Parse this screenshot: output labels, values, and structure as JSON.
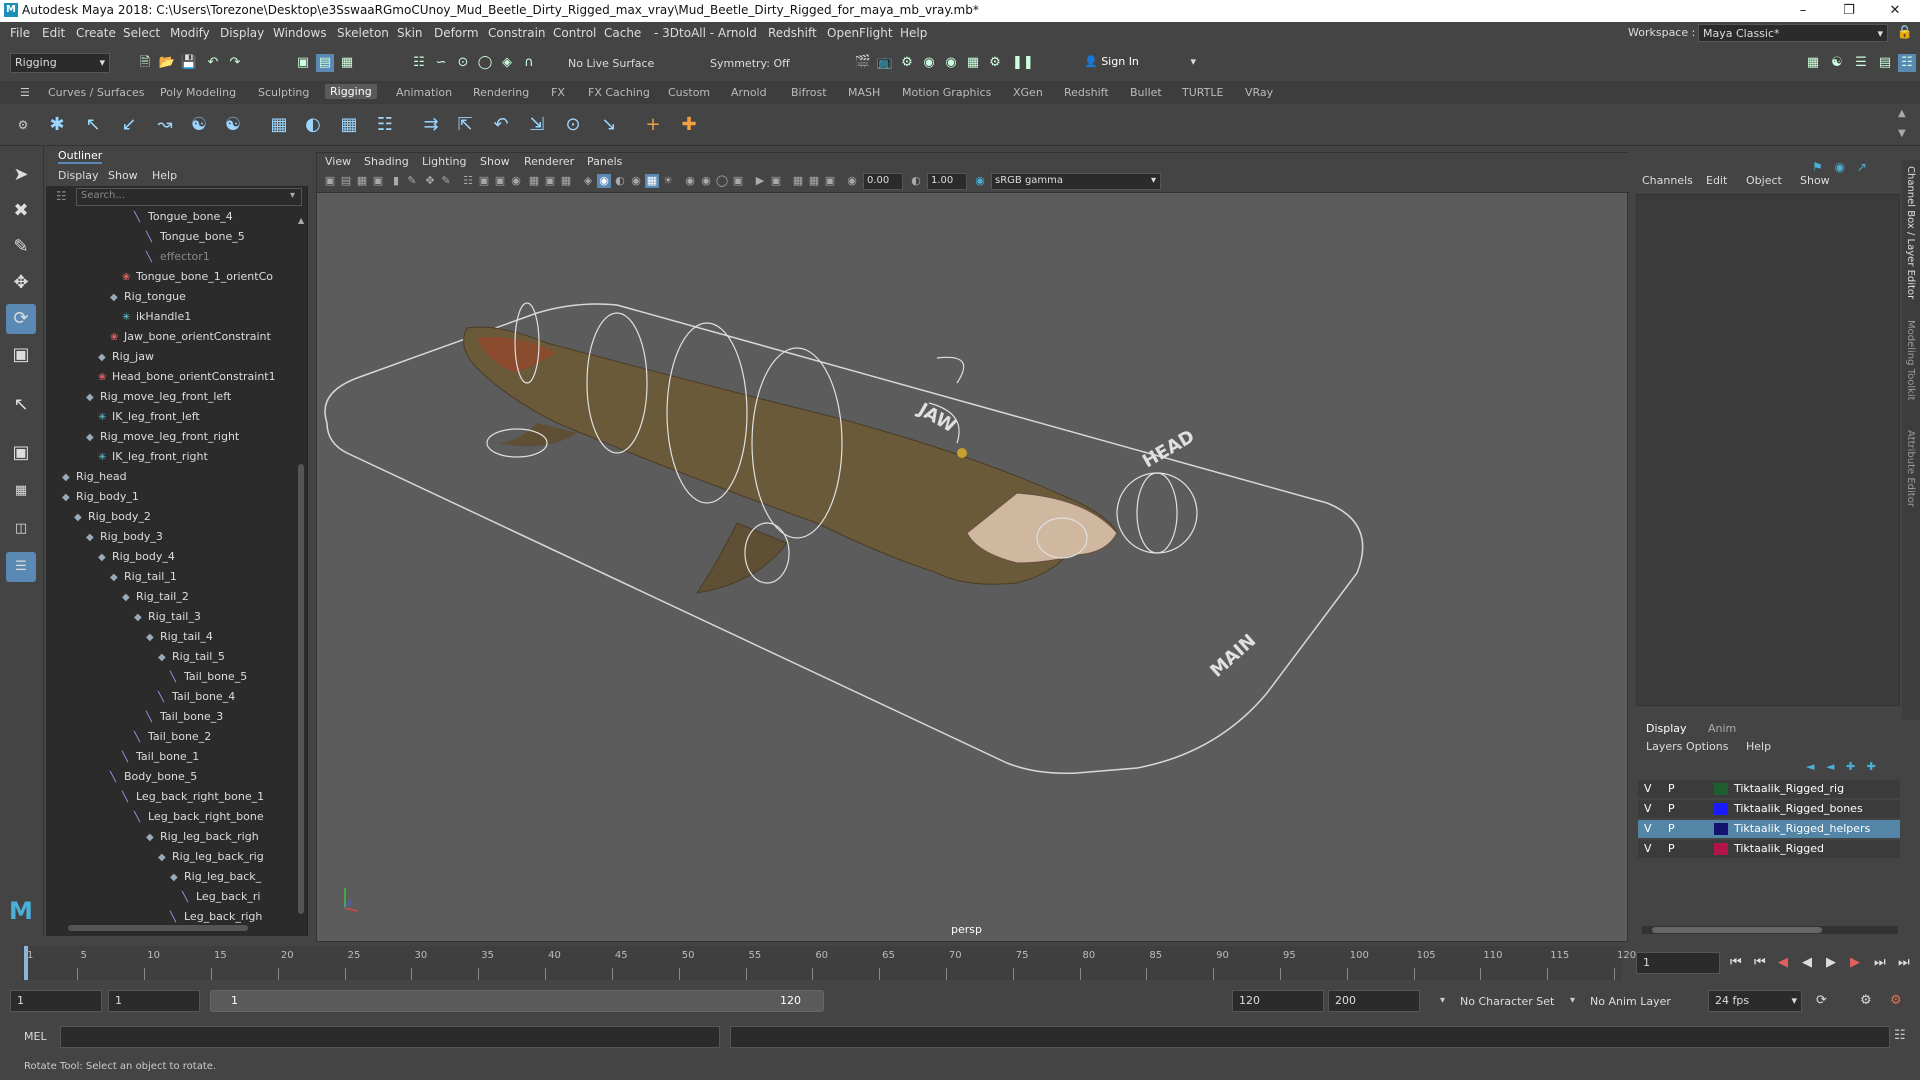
{
  "window": {
    "title": "Autodesk Maya 2018: C:\\Users\\Torezone\\Desktop\\e3SswaaRGmoCUnoy_Mud_Beetle_Dirty_Rigged_max_vray\\Mud_Beetle_Dirty_Rigged_for_maya_mb_vray.mb*",
    "logo": "M"
  },
  "menu": [
    "File",
    "Edit",
    "Create",
    "Select",
    "Modify",
    "Display",
    "Windows",
    "Skeleton",
    "Skin",
    "Deform",
    "Constrain",
    "Control",
    "Cache",
    "- 3DtoAll -",
    "Arnold",
    "Redshift",
    "OpenFlight",
    "Help"
  ],
  "workspace": {
    "label": "Workspace :",
    "value": "Maya Classic*"
  },
  "statusline": {
    "mode": "Rigging",
    "live_surface": "No Live Surface",
    "symmetry": "Symmetry: Off",
    "sign_in": "Sign In"
  },
  "shelf_tabs": [
    "Curves / Surfaces",
    "Poly Modeling",
    "Sculpting",
    "Rigging",
    "Animation",
    "Rendering",
    "FX",
    "FX Caching",
    "Custom",
    "Arnold",
    "Bifrost",
    "MASH",
    "Motion Graphics",
    "XGen",
    "Redshift",
    "Bullet",
    "TURTLE",
    "VRay"
  ],
  "active_shelf": "Rigging",
  "outliner": {
    "title": "Outliner",
    "menu": [
      "Display",
      "Show",
      "Help"
    ],
    "search_placeholder": "Search...",
    "rows": [
      {
        "label": "Tongue_bone_4",
        "indent": 8,
        "icon": "joint"
      },
      {
        "label": "Tongue_bone_5",
        "indent": 9,
        "icon": "joint"
      },
      {
        "label": "effector1",
        "indent": 9,
        "icon": "joint",
        "dim": true
      },
      {
        "label": "Tongue_bone_1_orientCo",
        "indent": 7,
        "icon": "const"
      },
      {
        "label": "Rig_tongue",
        "indent": 6,
        "icon": "ctrl"
      },
      {
        "label": "ikHandle1",
        "indent": 7,
        "icon": "ik"
      },
      {
        "label": "Jaw_bone_orientConstraint",
        "indent": 6,
        "icon": "const"
      },
      {
        "label": "Rig_jaw",
        "indent": 5,
        "icon": "ctrl"
      },
      {
        "label": "Head_bone_orientConstraint1",
        "indent": 5,
        "icon": "const"
      },
      {
        "label": "Rig_move_leg_front_left",
        "indent": 4,
        "icon": "ctrl"
      },
      {
        "label": "IK_leg_front_left",
        "indent": 5,
        "icon": "ik"
      },
      {
        "label": "Rig_move_leg_front_right",
        "indent": 4,
        "icon": "ctrl"
      },
      {
        "label": "IK_leg_front_right",
        "indent": 5,
        "icon": "ik"
      },
      {
        "label": "Rig_head",
        "indent": 2,
        "icon": "ctrl"
      },
      {
        "label": "Rig_body_1",
        "indent": 2,
        "icon": "ctrl"
      },
      {
        "label": "Rig_body_2",
        "indent": 3,
        "icon": "ctrl"
      },
      {
        "label": "Rig_body_3",
        "indent": 4,
        "icon": "ctrl"
      },
      {
        "label": "Rig_body_4",
        "indent": 5,
        "icon": "ctrl"
      },
      {
        "label": "Rig_tail_1",
        "indent": 6,
        "icon": "ctrl"
      },
      {
        "label": "Rig_tail_2",
        "indent": 7,
        "icon": "ctrl"
      },
      {
        "label": "Rig_tail_3",
        "indent": 8,
        "icon": "ctrl"
      },
      {
        "label": "Rig_tail_4",
        "indent": 9,
        "icon": "ctrl"
      },
      {
        "label": "Rig_tail_5",
        "indent": 10,
        "icon": "ctrl"
      },
      {
        "label": "Tail_bone_5",
        "indent": 11,
        "icon": "joint"
      },
      {
        "label": "Tail_bone_4",
        "indent": 10,
        "icon": "joint"
      },
      {
        "label": "Tail_bone_3",
        "indent": 9,
        "icon": "joint"
      },
      {
        "label": "Tail_bone_2",
        "indent": 8,
        "icon": "joint"
      },
      {
        "label": "Tail_bone_1",
        "indent": 7,
        "icon": "joint"
      },
      {
        "label": "Body_bone_5",
        "indent": 6,
        "icon": "joint"
      },
      {
        "label": "Leg_back_right_bone_1",
        "indent": 7,
        "icon": "joint"
      },
      {
        "label": "Leg_back_right_bone",
        "indent": 8,
        "icon": "joint"
      },
      {
        "label": "Rig_leg_back_righ",
        "indent": 9,
        "icon": "ctrl"
      },
      {
        "label": "Rig_leg_back_rig",
        "indent": 10,
        "icon": "ctrl"
      },
      {
        "label": "Rig_leg_back_",
        "indent": 11,
        "icon": "ctrl"
      },
      {
        "label": "Leg_back_ri",
        "indent": 12,
        "icon": "joint"
      },
      {
        "label": "Leg_back_righ",
        "indent": 11,
        "icon": "joint"
      }
    ]
  },
  "viewport": {
    "menu": [
      "View",
      "Shading",
      "Lighting",
      "Show",
      "Renderer",
      "Panels"
    ],
    "field_a": "0.00",
    "field_b": "1.00",
    "color_space": "sRGB gamma",
    "camera": "persp",
    "labels": {
      "jaw": "JAW",
      "head": "HEAD",
      "main": "MAIN"
    }
  },
  "channel_box": {
    "menu": [
      "Channels",
      "Edit",
      "Object",
      "Show"
    ]
  },
  "side_tabs": [
    "Channel Box / Layer Editor",
    "Modeling Toolkit",
    "Attribute Editor"
  ],
  "layers": {
    "tabs": [
      "Display",
      "Anim"
    ],
    "menu": [
      "Layers",
      "Options",
      "Help"
    ],
    "rows": [
      {
        "v": "V",
        "p": "P",
        "name": "Tiktaalik_Rigged_rig",
        "color": "#1f5e2e",
        "selected": false
      },
      {
        "v": "V",
        "p": "P",
        "name": "Tiktaalik_Rigged_bones",
        "color": "#1a1aff",
        "selected": false
      },
      {
        "v": "V",
        "p": "P",
        "name": "Tiktaalik_Rigged_helpers",
        "color": "#14146e",
        "selected": true
      },
      {
        "v": "V",
        "p": "P",
        "name": "Tiktaalik_Rigged",
        "color": "#b0144a",
        "selected": false
      }
    ]
  },
  "timeline": {
    "ticks": [
      "1",
      "5",
      "10",
      "15",
      "20",
      "25",
      "30",
      "35",
      "40",
      "45",
      "50",
      "55",
      "60",
      "65",
      "70",
      "75",
      "80",
      "85",
      "90",
      "95",
      "100",
      "105",
      "110",
      "115",
      "120"
    ],
    "current_frame": "1"
  },
  "range": {
    "start": "1",
    "start2": "1",
    "slider_start": "1",
    "slider_end": "120",
    "end": "120",
    "end2": "200",
    "character_set": "No Character Set",
    "anim_layer": "No Anim Layer",
    "fps": "24 fps"
  },
  "command": {
    "label": "MEL"
  },
  "help_line": "Rotate Tool: Select an object to rotate."
}
